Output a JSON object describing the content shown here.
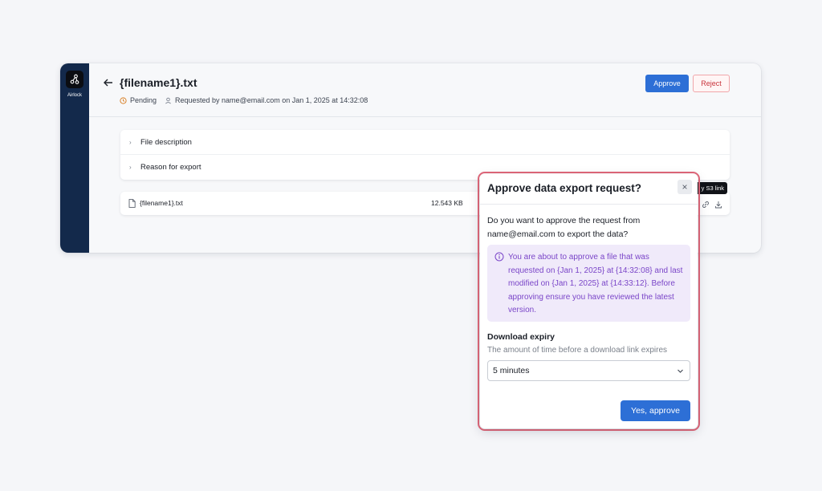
{
  "sidebar": {
    "logo_icon": "airlock-logo-icon",
    "logo_label": "Airlock"
  },
  "header": {
    "title": "{filename1}.txt",
    "status": "Pending",
    "requested_text": "Requested by name@email.com on Jan 1, 2025 at 14:32:08",
    "approve_label": "Approve",
    "reject_label": "Reject"
  },
  "accordion": {
    "items": [
      {
        "label": "File description"
      },
      {
        "label": "Reason for export"
      }
    ]
  },
  "files": [
    {
      "name": "{filename1}.txt",
      "size": "12.543 KB"
    }
  ],
  "tooltip": {
    "text": "y S3 link"
  },
  "dialog": {
    "title": "Approve data export request?",
    "close_icon": "close-icon",
    "question": "Do you want to approve the request from name@email.com to export the data?",
    "info": "You are about to approve a file that was requested on {Jan 1, 2025} at {14:32:08} and last modified on {Jan 1, 2025} at {14:33:12}. Before approving ensure you have reviewed the latest version.",
    "expiry_label": "Download expiry",
    "expiry_hint": "The amount of time before a download link expires",
    "expiry_value": "5 minutes",
    "confirm_label": "Yes, approve"
  },
  "colors": {
    "accent": "#2d6fd6",
    "sidebar": "#13294b",
    "danger": "#c8333b",
    "highlight_ring": "#e2687a",
    "info_bg": "#f0eafa",
    "info_text": "#7a45c8"
  }
}
